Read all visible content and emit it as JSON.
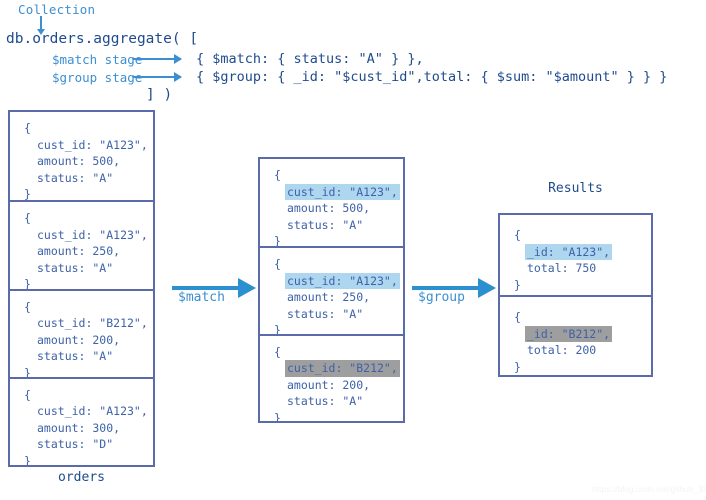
{
  "diagram": {
    "title_label": "Collection",
    "code": {
      "line1": "db.orders.aggregate( [",
      "match_stage_label": "$match stage",
      "group_stage_label": "$group stage",
      "match_stage_code": "{ $match: { status: \"A\" } },",
      "group_stage_code": "{ $group: { _id: \"$cust_id\",total: { $sum: \"$amount\" } } }",
      "closing": "] )"
    },
    "arrows": [
      {
        "name": "match",
        "label": "$match"
      },
      {
        "name": "group",
        "label": "$group"
      }
    ],
    "colors": {
      "accent_blue": "#3d8fd1",
      "arrow_blue": "#2b8fd0",
      "text_navy": "#1f4b8e",
      "doc_text": "#3e62a8",
      "box_border": "#5b6aa8",
      "highlight_blue": "#aed6ef",
      "highlight_gray": "#9e9e9e"
    },
    "watermark": "https://blog.csdn.net/github_33885296"
  },
  "orders_collection": {
    "caption": "orders",
    "documents": [
      {
        "open": "{",
        "fields": [
          "cust_id: \"A123\",",
          "amount: 500,",
          "status: \"A\""
        ],
        "close": "}",
        "highlight": "none"
      },
      {
        "open": "{",
        "fields": [
          "cust_id: \"A123\",",
          "amount: 250,",
          "status: \"A\""
        ],
        "close": "}",
        "highlight": "none"
      },
      {
        "open": "{",
        "fields": [
          "cust_id: \"B212\",",
          "amount: 200,",
          "status: \"A\""
        ],
        "close": "}",
        "highlight": "none"
      },
      {
        "open": "{",
        "fields": [
          "cust_id: \"A123\",",
          "amount: 300,",
          "status: \"D\""
        ],
        "close": "}",
        "highlight": "none"
      }
    ]
  },
  "match_output": {
    "documents": [
      {
        "open": "{",
        "fields": [
          "cust_id: \"A123\",",
          "amount: 500,",
          "status: \"A\""
        ],
        "close": "}",
        "highlight": "blue"
      },
      {
        "open": "{",
        "fields": [
          "cust_id: \"A123\",",
          "amount: 250,",
          "status: \"A\""
        ],
        "close": "}",
        "highlight": "blue"
      },
      {
        "open": "{",
        "fields": [
          "cust_id: \"B212\",",
          "amount: 200,",
          "status: \"A\""
        ],
        "close": "}",
        "highlight": "gray"
      }
    ]
  },
  "results": {
    "caption": "Results",
    "documents": [
      {
        "open": "{",
        "fields": [
          "_id: \"A123\",",
          "total: 750"
        ],
        "close": "}",
        "highlight": "blue"
      },
      {
        "open": "{",
        "fields": [
          "_id: \"B212\",",
          "total: 200"
        ],
        "close": "}",
        "highlight": "gray"
      }
    ]
  }
}
